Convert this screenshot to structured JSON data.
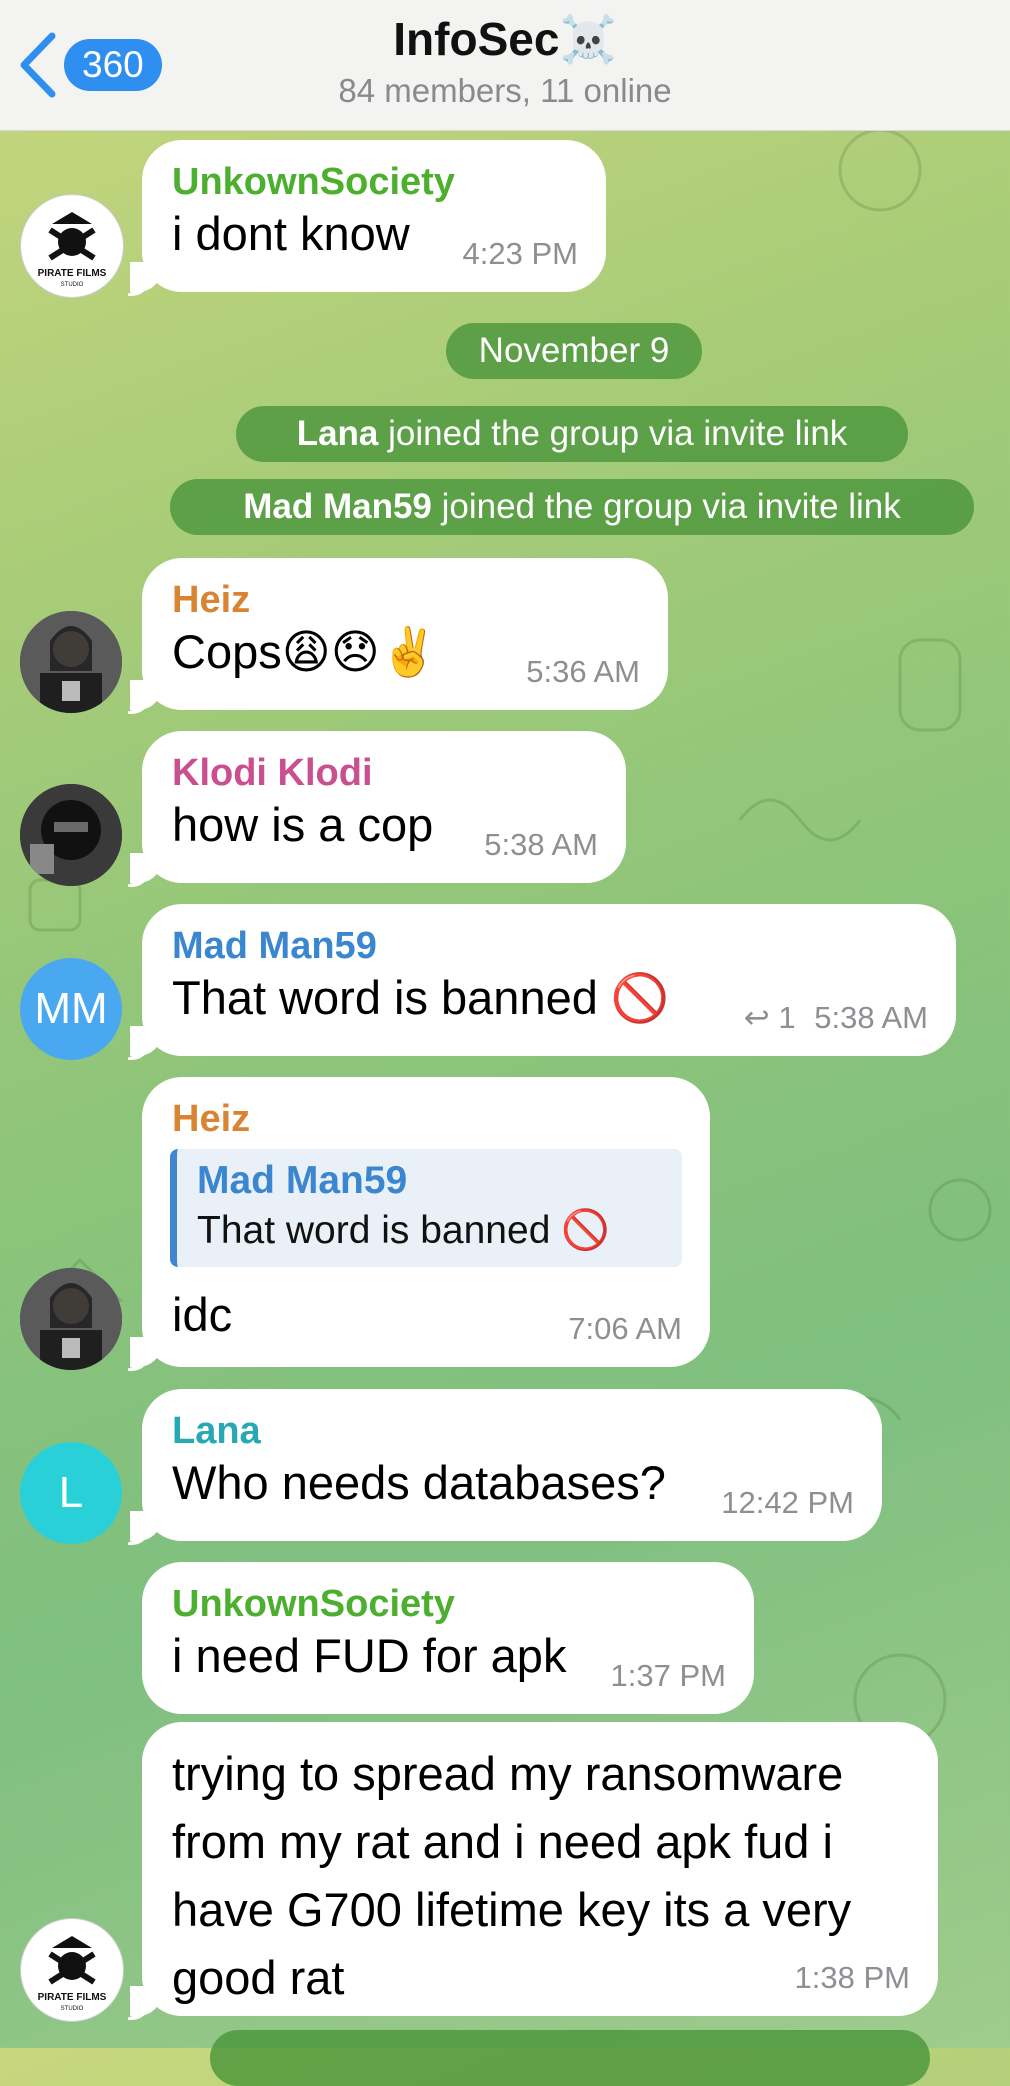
{
  "header": {
    "back_count": "360",
    "title": "InfoSec",
    "title_emoji": "☠️",
    "subtitle": "84 members, 11 online"
  },
  "date_separator": "November 9",
  "service_messages": [
    {
      "name": "Lana",
      "text": " joined the group via invite link"
    },
    {
      "name": "Mad Man59",
      "text": " joined the group via invite link"
    }
  ],
  "messages": [
    {
      "sender": "UnkownSociety",
      "text": "i dont know",
      "time": "4:23 PM",
      "color": "#4caf2e",
      "avatar": "pirate-films-logo"
    },
    {
      "sender": "Heiz",
      "text": "Cops😩😞✌️",
      "time": "5:36 AM",
      "color": "#d98432",
      "avatar": "photo"
    },
    {
      "sender": "Klodi Klodi",
      "text": "how is a cop",
      "time": "5:38 AM",
      "color": "#c94f8e",
      "avatar": "photo"
    },
    {
      "sender": "Mad Man59",
      "text": "That word is banned 🚫",
      "forward_count": "1",
      "time": "5:38 AM",
      "color": "#3a86cf",
      "avatar_initials": "MM"
    },
    {
      "sender": "Heiz",
      "reply_to_name": "Mad Man59",
      "reply_to_text": "That word is banned 🚫",
      "text": "idc",
      "time": "7:06 AM",
      "color": "#d98432",
      "avatar": "photo"
    },
    {
      "sender": "Lana",
      "text": "Who needs databases?",
      "time": "12:42 PM",
      "color": "#26a9b5",
      "avatar_initials": "L"
    },
    {
      "sender": "UnkownSociety",
      "text": "i need FUD for apk",
      "time": "1:37 PM",
      "color": "#4caf2e"
    },
    {
      "text_lines": [
        "trying to spread my ransomware",
        "from my rat and i need apk fud i",
        "have G700 lifetime key its a very",
        "good rat"
      ],
      "time": "1:38 PM",
      "avatar": "pirate-films-logo"
    }
  ],
  "avatar_logo_text": "PIRATE FILMS",
  "avatar_logo_sub": "STUDIO",
  "colors": {
    "accent": "#2f8ff0",
    "mm_avatar": "#4aa8f0",
    "l_avatar": "#2ad0d8",
    "pill": "#4c963c"
  }
}
